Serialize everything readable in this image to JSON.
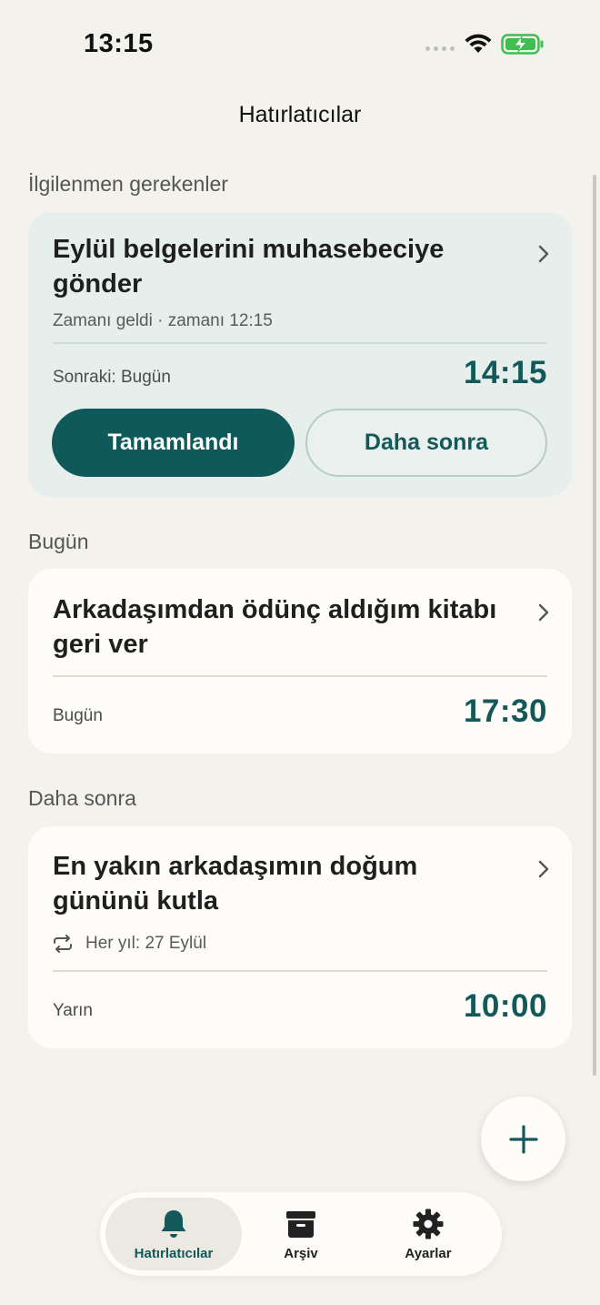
{
  "status_bar": {
    "time": "13:15"
  },
  "header": {
    "title": "Hatırlatıcılar"
  },
  "sections": {
    "attention": {
      "label": "İlgilenmen gerekenler",
      "card": {
        "title": "Eylül belgelerini muhasebeciye gönder",
        "subtitle": "Zamanı geldi · zamanı 12:15",
        "next_label": "Sonraki: Bugün",
        "time": "14:15",
        "done_button": "Tamamlandı",
        "later_button": "Daha sonra"
      }
    },
    "today": {
      "label": "Bugün",
      "card": {
        "title": "Arkadaşımdan ödünç aldığım kitabı geri ver",
        "day": "Bugün",
        "time": "17:30"
      }
    },
    "later": {
      "label": "Daha sonra",
      "card": {
        "title": "En yakın arkadaşımın doğum gününü kutla",
        "repeat": "Her yıl: 27 Eylül",
        "day": "Yarın",
        "time": "10:00"
      }
    }
  },
  "tab_bar": {
    "items": [
      {
        "label": "Hatırlatıcılar",
        "icon": "bell-icon",
        "active": true
      },
      {
        "label": "Arşiv",
        "icon": "archive-icon",
        "active": false
      },
      {
        "label": "Ayarlar",
        "icon": "gear-icon",
        "active": false
      }
    ]
  },
  "colors": {
    "accent": "#10595a",
    "background": "#f4f2ec",
    "card": "#fdfcf8",
    "attention_card": "#e6efec"
  }
}
